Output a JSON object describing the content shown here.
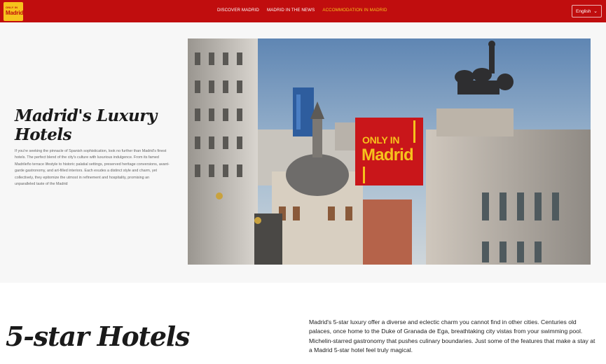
{
  "header": {
    "logo_line1": "ONLY IN",
    "logo_line2": "Madrid",
    "nav": [
      {
        "label": "DISCOVER MADRID",
        "active": false
      },
      {
        "label": "MADRID IN THE NEWS",
        "active": false
      },
      {
        "label": "ACCOMMODATION IN MADRID",
        "active": true
      }
    ],
    "language": "English",
    "language_icon": "chevron-down-icon"
  },
  "hero": {
    "title": "Madrid's Luxury Hotels",
    "description": "If you're seeking the pinnacle of Spanish sophistication, look no further than Madrid's finest hotels. The perfect blend of the city's culture with luxurious indulgence. From its famed Madrileño terrace lifestyle to historic palatial settings, preserved heritage conversions, avant-garde gastronomy, and art-filled interiors. Each exudes a distinct style and charm, yet collectively, they epitomize the utmost in refinement and hospitality, promising an unparalleled taste of the Madrid",
    "image_badge_line1": "ONLY IN",
    "image_badge_line2": "Madrid"
  },
  "five_star": {
    "title": "5-star Hotels",
    "description": "Madrid's 5-star luxury offer a diverse and eclectic charm you cannot find in other cities. Centuries old palaces, once home to the Duke of Granada de Ega, breathtaking city vistas from your swimming pool. Michelin-starred gastronomy that pushes culinary boundaries. Just some of the features that make a stay at a Madrid 5-star hotel feel truly magical."
  },
  "colors": {
    "brand_red": "#c00d0e",
    "brand_yellow": "#f6c21c",
    "hero_bg": "#f7f7f7"
  }
}
